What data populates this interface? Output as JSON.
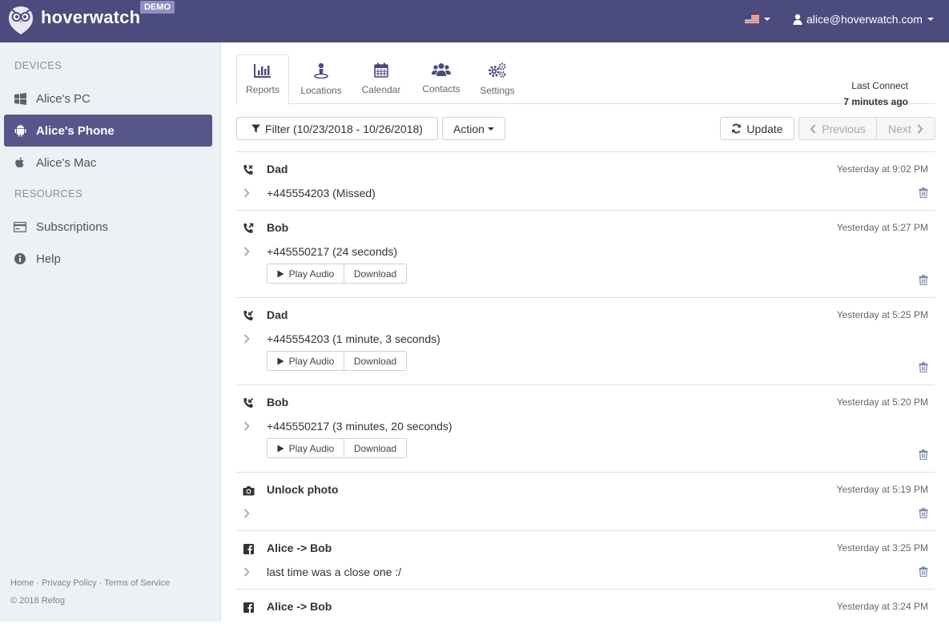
{
  "header": {
    "brand": "hoverwatch",
    "badge": "DEMO",
    "user_email": "alice@hoverwatch.com"
  },
  "sidebar": {
    "devices_heading": "DEVICES",
    "devices": [
      {
        "label": "Alice's PC",
        "icon": "windows-icon"
      },
      {
        "label": "Alice's Phone",
        "icon": "android-icon"
      },
      {
        "label": "Alice's Mac",
        "icon": "apple-icon"
      }
    ],
    "resources_heading": "RESOURCES",
    "resources": [
      {
        "label": "Subscriptions",
        "icon": "credit-card-icon"
      },
      {
        "label": "Help",
        "icon": "info-icon"
      }
    ],
    "footer_links": [
      "Home",
      "Privacy Policy",
      "Terms of Service"
    ],
    "footer_sep": "·",
    "copyright": "© 2018 Refog"
  },
  "tabs": [
    {
      "label": "Reports",
      "icon": "bar-chart-icon"
    },
    {
      "label": "Locations",
      "icon": "map-pin-icon"
    },
    {
      "label": "Calendar",
      "icon": "calendar-icon"
    },
    {
      "label": "Contacts",
      "icon": "users-icon"
    },
    {
      "label": "Settings",
      "icon": "gears-icon"
    }
  ],
  "last_connect": {
    "label": "Last Connect",
    "value": "7 minutes ago"
  },
  "toolbar": {
    "filter": "Filter (10/23/2018 - 10/26/2018)",
    "action": "Action",
    "update": "Update",
    "previous": "Previous",
    "next": "Next"
  },
  "events": [
    {
      "type": "call-missed",
      "title": "Dad",
      "time": "Yesterday at 9:02 PM",
      "detail": "+445554203 (Missed)",
      "audio": false
    },
    {
      "type": "call-out",
      "title": "Bob",
      "time": "Yesterday at 5:27 PM",
      "detail": "+445550217 (24 seconds)",
      "audio": true
    },
    {
      "type": "call-in",
      "title": "Dad",
      "time": "Yesterday at 5:25 PM",
      "detail": "+445554203 (1 minute, 3 seconds)",
      "audio": true
    },
    {
      "type": "call-in",
      "title": "Bob",
      "time": "Yesterday at 5:20 PM",
      "detail": "+445550217 (3 minutes, 20 seconds)",
      "audio": true
    },
    {
      "type": "photo",
      "title": "Unlock photo",
      "time": "Yesterday at 5:19 PM",
      "detail": "",
      "audio": false
    },
    {
      "type": "facebook",
      "title": "Alice -> Bob",
      "time": "Yesterday at 3:25 PM",
      "detail": "last time was a close one :/",
      "audio": false
    },
    {
      "type": "facebook",
      "title": "Alice -> Bob",
      "time": "Yesterday at 3:24 PM",
      "detail": "",
      "audio": false
    }
  ],
  "audio_buttons": {
    "play": "Play Audio",
    "download": "Download"
  }
}
